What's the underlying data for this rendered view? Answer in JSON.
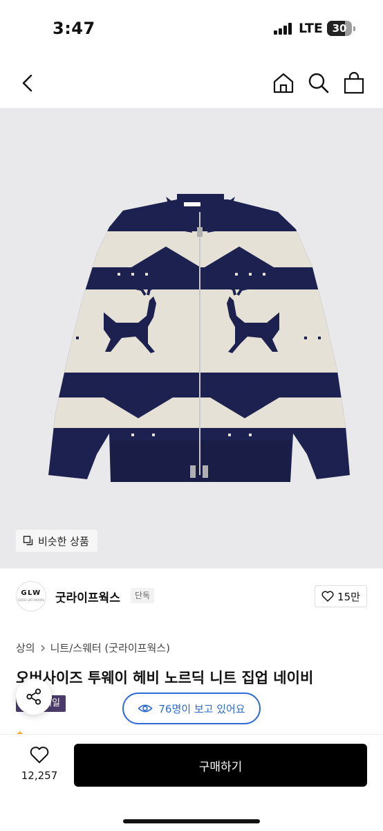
{
  "status_bar": {
    "time": "3:47",
    "network": "LTE",
    "battery": "30"
  },
  "nav": {
    "icons": [
      "back-icon",
      "home-icon",
      "search-icon",
      "shopping-bag-icon"
    ]
  },
  "hero": {
    "similar_label": "비슷한 상품"
  },
  "brand": {
    "logo_text": "GLW",
    "logo_sub": "GOOD LIFE WORKS",
    "name": "굿라이프웍스",
    "tag": "단독",
    "likes": "15만"
  },
  "product": {
    "breadcrumb": [
      "상의",
      "니트/스웨터 (굿라이프웍스)"
    ],
    "title": "오버사이즈 투웨이 헤비 노르딕 니트 집업 네이비",
    "badge": "세일",
    "viewing": "76명이 보고 있어요"
  },
  "bottom": {
    "wish_count": "12,257",
    "buy_label": "구매하기"
  },
  "colors": {
    "accent_blue": "#2d6bd6",
    "badge_purple": "#4a3b6b",
    "buy_black": "#000000",
    "sweater_navy": "#1c2150",
    "sweater_cream": "#e6e1d6"
  }
}
